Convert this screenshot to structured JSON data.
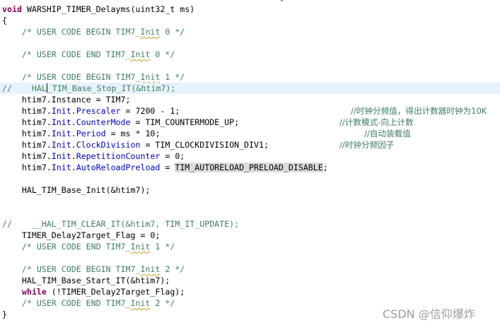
{
  "code": {
    "l01": {
      "a": "void",
      "b": " WARSHIP_TIMER_Delayms(uint32_t ms)"
    },
    "l02": "{",
    "l03": {
      "a": "    /* USER CODE BEGIN TIM7_",
      "b": "Init",
      "c": " 0 */"
    },
    "l04": {
      "a": "    /* USER CODE END TIM7_",
      "b": "Init",
      "c": " 0 */"
    },
    "l05": {
      "a": "    /* USER CODE BEGIN TIM7_",
      "b": "Init",
      "c": " 1 */"
    },
    "l06": {
      "a": "//    HAL",
      "b": "_TIM_Base_Stop_IT(&htim7);"
    },
    "l07": "    htim7.Instance = TIM7;",
    "l08": {
      "a": "    htim7.",
      "b": "Init",
      "c": ".",
      "d": "Prescaler",
      "e": " = 7200 - 1;",
      "f": "//时钟分频值，得出计数器时钟为10K"
    },
    "l09": {
      "a": "    htim7.",
      "b": "Init",
      "c": ".",
      "d": "CounterMode",
      "e": " = TIM_COUNTERMODE_UP;",
      "f": "//计数模式-向上计数"
    },
    "l10": {
      "a": "    htim7.",
      "b": "Init",
      "c": ".",
      "d": "Period",
      "e": " = ms * 10;",
      "f": "//自动装载值"
    },
    "l11": {
      "a": "    htim7.",
      "b": "Init",
      "c": ".",
      "d": "ClockDivision",
      "e": " = TIM_CLOCKDIVISION_DIV1;",
      "f": "//时钟分频因子"
    },
    "l12": {
      "a": "    htim7.",
      "b": "Init",
      "c": ".",
      "d": "RepetitionCounter",
      "e": " = 0;"
    },
    "l13": {
      "a": "    htim7.",
      "b": "Init",
      "c": ".",
      "d": "AutoReloadPreload",
      "e": " = ",
      "f": "TIM_AUTORELOAD_PRELOAD_DISABLE",
      "g": ";"
    },
    "l14": "    HAL_TIM_Base_Init(&htim7);",
    "l15": "//    __HAL_TIM_CLEAR_IT(&htim7, TIM_IT_UPDATE);",
    "l16": "    TIMER_Delay2Target_Flag = 0;",
    "l17": {
      "a": "    /* USER CODE END TIM7_",
      "b": "Init",
      "c": " 1 */"
    },
    "l18": {
      "a": "    /* USER CODE BEGIN TIM7_",
      "b": "Init",
      "c": " 2 */"
    },
    "l19": "    HAL_TIM_Base_Start_IT(&htim7);",
    "l20": {
      "a": "    ",
      "b": "while",
      "c": " (!TIMER_Delay2Target_Flag);"
    },
    "l21": {
      "a": "    /* USER CODE END TIM7_",
      "b": "Init",
      "c": " 2 */"
    },
    "l22": "}"
  },
  "watermark": "CSDN @信仰爆炸",
  "colors": {
    "keyword": "#7f0055",
    "comment": "#3f7f5f",
    "field": "#0000c0",
    "highlight_line": "#e8f2fe"
  }
}
